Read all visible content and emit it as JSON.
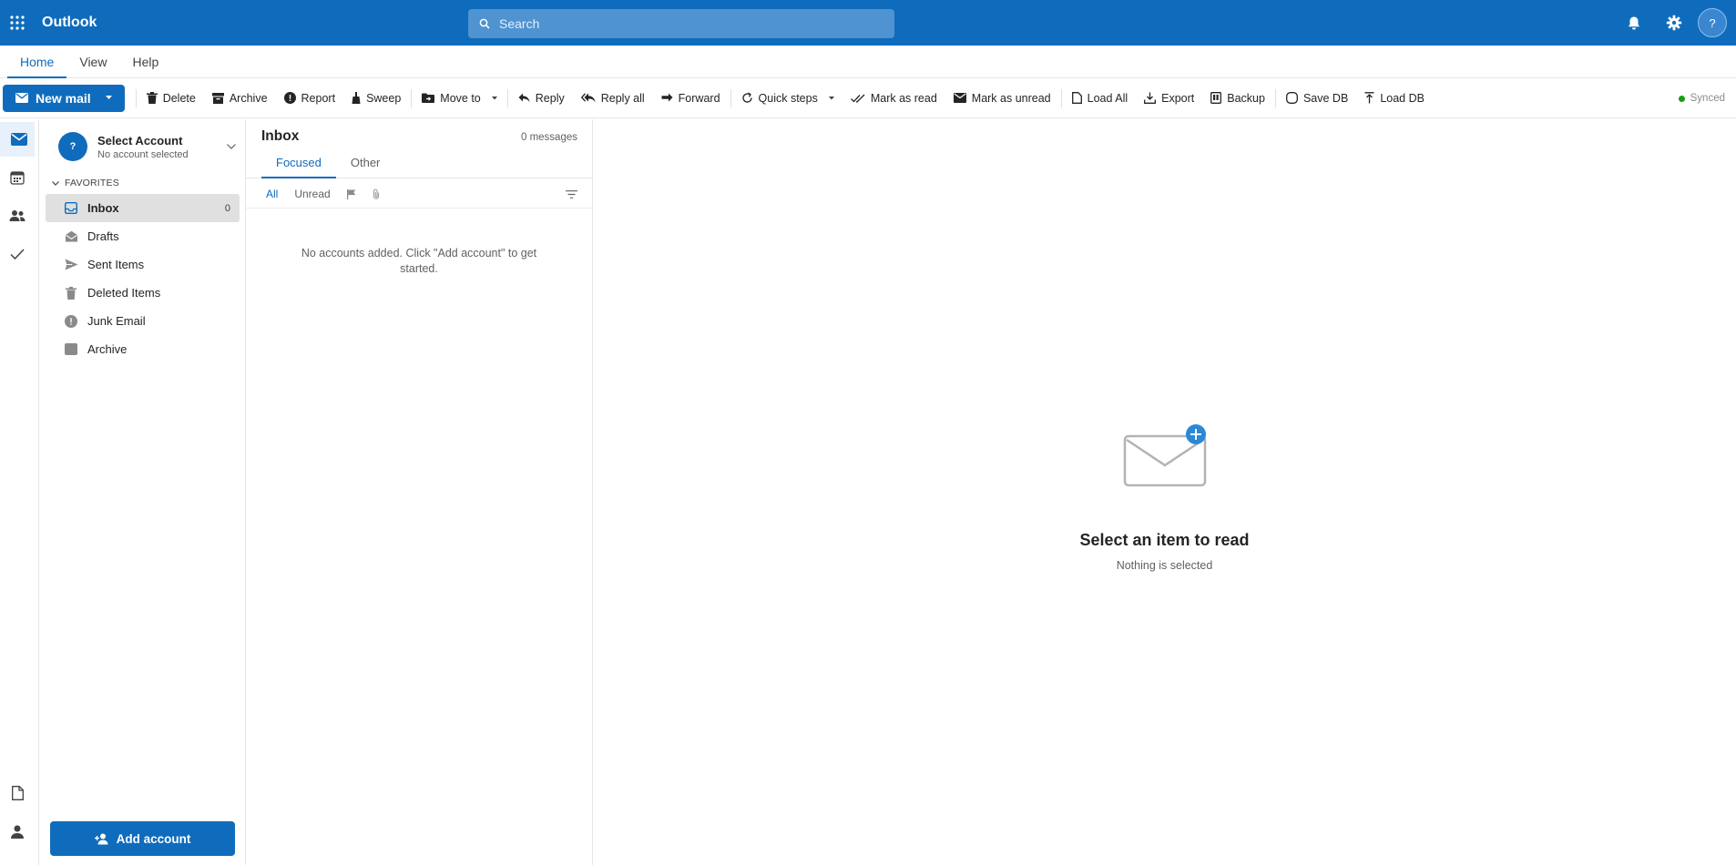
{
  "app": {
    "title": "Outlook"
  },
  "search": {
    "placeholder": "Search"
  },
  "header": {
    "avatar_initial": "?"
  },
  "ribbon": {
    "tabs": [
      {
        "label": "Home"
      },
      {
        "label": "View"
      },
      {
        "label": "Help"
      }
    ]
  },
  "toolbar": {
    "new_mail": "New mail",
    "delete": "Delete",
    "archive": "Archive",
    "report": "Report",
    "sweep": "Sweep",
    "move_to": "Move to",
    "reply": "Reply",
    "reply_all": "Reply all",
    "forward": "Forward",
    "quick_steps": "Quick steps",
    "mark_read": "Mark as read",
    "mark_unread": "Mark as unread",
    "load_all": "Load All",
    "export": "Export",
    "backup": "Backup",
    "save_db": "Save DB",
    "load_db": "Load DB",
    "status": "Synced",
    "status_color": "#13a10e"
  },
  "account": {
    "initial": "?",
    "name": "Select Account",
    "sub": "No account selected"
  },
  "favorites": {
    "header": "FAVORITES",
    "folders": [
      {
        "name": "Inbox",
        "count": "0",
        "icon": "inbox-icon"
      },
      {
        "name": "Drafts",
        "icon": "drafts-icon"
      },
      {
        "name": "Sent Items",
        "icon": "send-icon"
      },
      {
        "name": "Deleted Items",
        "icon": "trash-icon"
      },
      {
        "name": "Junk Email",
        "icon": "junk-icon"
      },
      {
        "name": "Archive",
        "icon": "archive-icon"
      }
    ]
  },
  "add_account": "Add account",
  "message_list": {
    "title": "Inbox",
    "count": "0 messages",
    "tabs": [
      "Focused",
      "Other"
    ],
    "filters": [
      "All",
      "Unread"
    ],
    "empty": "No accounts added. Click \"Add account\" to get started."
  },
  "reading": {
    "title": "Select an item to read",
    "subtitle": "Nothing is selected"
  },
  "colors": {
    "brand": "#0f6cbd",
    "search_bg": "#4f93d1"
  }
}
